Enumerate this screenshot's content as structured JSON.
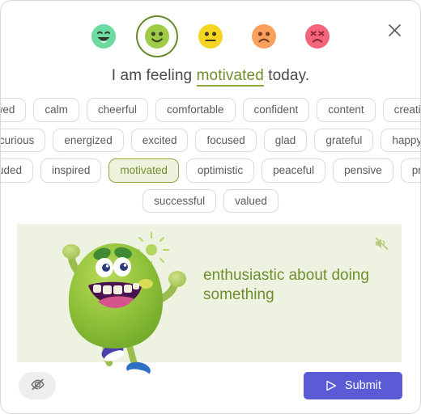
{
  "window": {
    "close_label": "close-icon"
  },
  "mood_scale": {
    "items": [
      {
        "name": "very-happy",
        "label": "very happy",
        "selected": false,
        "face": "#6ddba0",
        "feature": "#2f3a2a"
      },
      {
        "name": "happy",
        "label": "happy",
        "selected": true,
        "face": "#9ecc49",
        "feature": "#3a4422"
      },
      {
        "name": "neutral",
        "label": "neutral",
        "selected": false,
        "face": "#f4d522",
        "feature": "#3f3a1c"
      },
      {
        "name": "sad",
        "label": "sad",
        "selected": false,
        "face": "#f9a05e",
        "feature": "#7a3d1e"
      },
      {
        "name": "upset",
        "label": "upset",
        "selected": false,
        "face": "#f4647b",
        "feature": "#8e2a3c"
      }
    ]
  },
  "sentence": {
    "prefix": "I am feeling ",
    "word": "motivated",
    "suffix": " today."
  },
  "chips": {
    "rows": [
      [
        "awed",
        "calm",
        "cheerful",
        "comfortable",
        "confident",
        "content",
        "creative"
      ],
      [
        "curious",
        "energized",
        "excited",
        "focused",
        "glad",
        "grateful",
        "happy"
      ],
      [
        "included",
        "inspired",
        "motivated",
        "optimistic",
        "peaceful",
        "pensive",
        "proud"
      ],
      [
        "successful",
        "valued"
      ]
    ],
    "selected": "motivated"
  },
  "definition_panel": {
    "text": "enthusiastic about doing something",
    "mute_icon": "speaker-muted-icon",
    "illustration": "green-monster-character",
    "background_color": "#eef2e0",
    "text_color": "#6f8f2e"
  },
  "footer": {
    "hide_label": "eye-off-icon",
    "submit_label": "Submit",
    "submit_icon": "send-icon",
    "submit_color": "#5b5bd6"
  }
}
